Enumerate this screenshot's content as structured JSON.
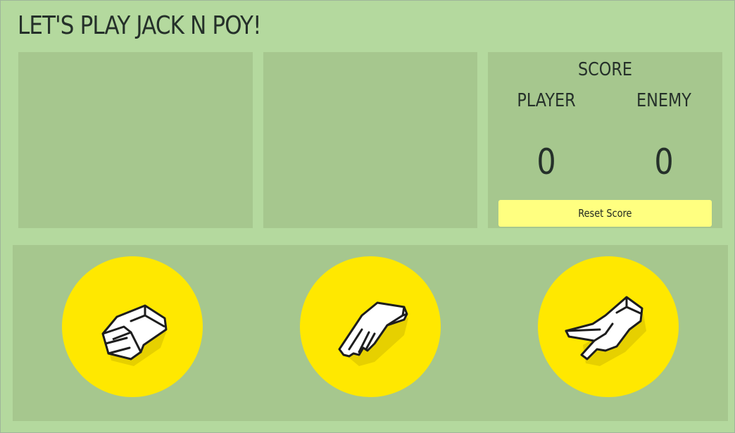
{
  "title": "LET'S PLAY JACK N POY!",
  "score": {
    "heading": "SCORE",
    "player_label": "PLAYER",
    "enemy_label": "ENEMY",
    "player_value": "0",
    "enemy_value": "0",
    "reset_label": "Reset Score"
  },
  "choices": [
    {
      "name": "rock",
      "icon": "rock-hand-icon"
    },
    {
      "name": "paper",
      "icon": "paper-hand-icon"
    },
    {
      "name": "scissors",
      "icon": "scissors-hand-icon"
    }
  ],
  "colors": {
    "background": "#b4d99e",
    "panel": "#a6c78e",
    "choice_circle": "#ffe800",
    "reset_button": "#ffff80",
    "text": "#25302a"
  }
}
